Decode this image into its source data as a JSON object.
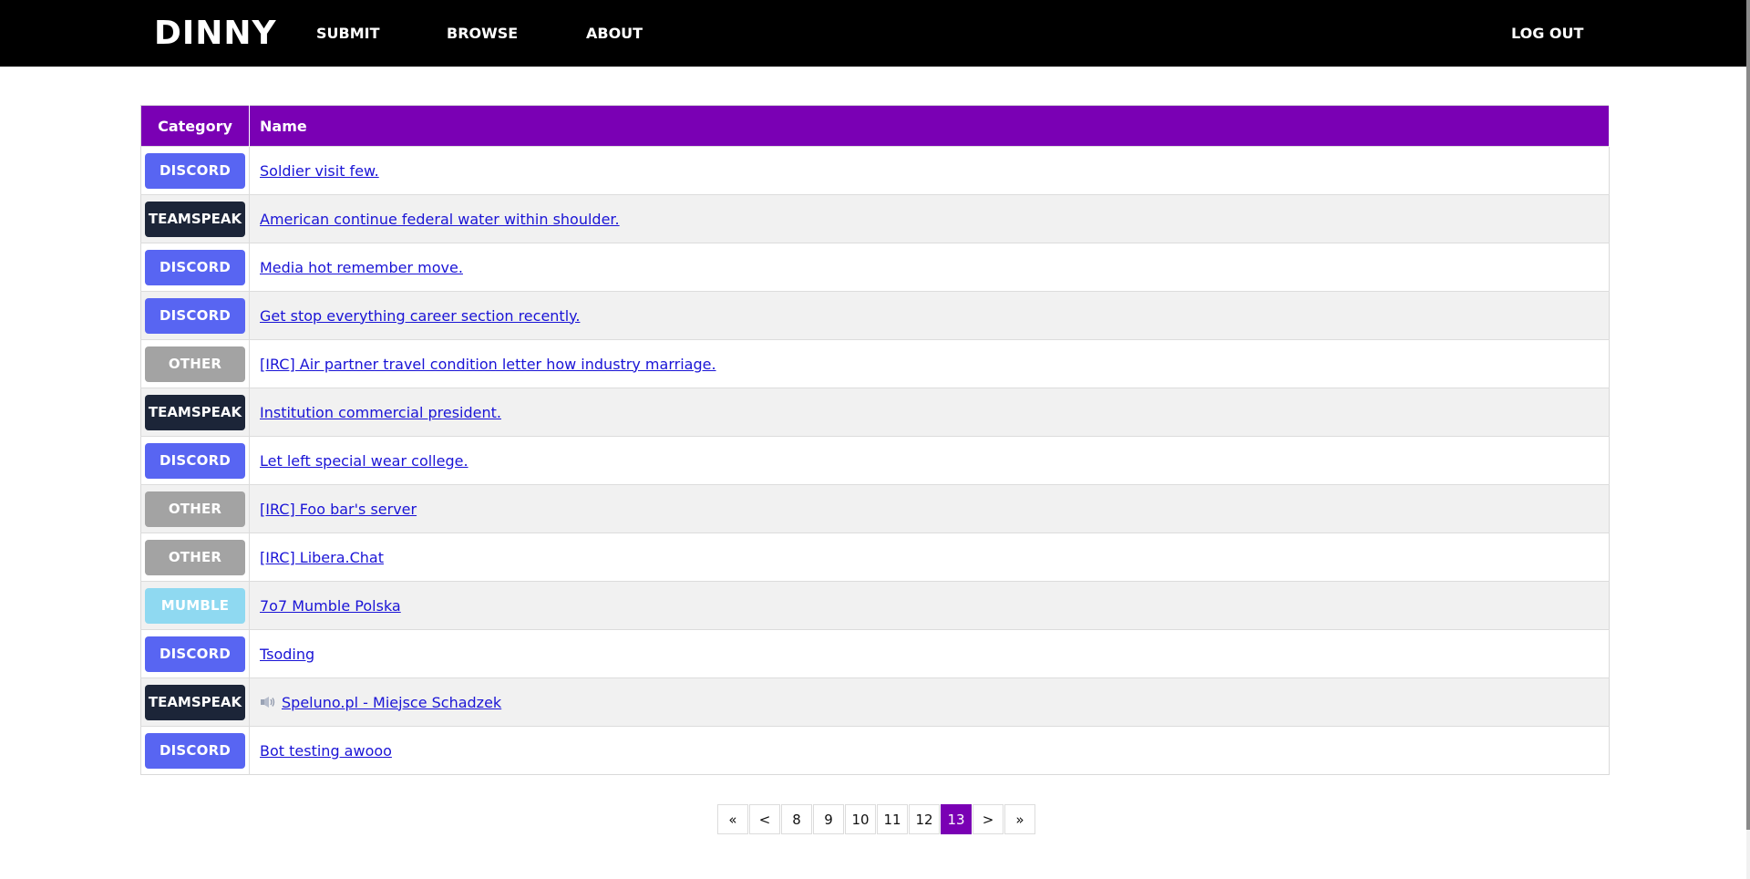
{
  "nav": {
    "brand": "DINNY",
    "submit": "SUBMIT",
    "browse": "BROWSE",
    "about": "ABOUT",
    "logout": "LOG OUT"
  },
  "table": {
    "headers": {
      "category": "Category",
      "name": "Name"
    },
    "rows": [
      {
        "category": "DISCORD",
        "type": "discord",
        "name": "Soldier visit few."
      },
      {
        "category": "TEAMSPEAK",
        "type": "teamspeak",
        "name": "American continue federal water within shoulder."
      },
      {
        "category": "DISCORD",
        "type": "discord",
        "name": "Media hot remember move."
      },
      {
        "category": "DISCORD",
        "type": "discord",
        "name": "Get stop everything career section recently."
      },
      {
        "category": "OTHER",
        "type": "other",
        "name": "[IRC] Air partner travel condition letter how industry marriage."
      },
      {
        "category": "TEAMSPEAK",
        "type": "teamspeak",
        "name": "Institution commercial president."
      },
      {
        "category": "DISCORD",
        "type": "discord",
        "name": "Let left special wear college."
      },
      {
        "category": "OTHER",
        "type": "other",
        "name": "[IRC] Foo bar's server"
      },
      {
        "category": "OTHER",
        "type": "other",
        "name": "[IRC] Libera.Chat"
      },
      {
        "category": "MUMBLE",
        "type": "mumble",
        "name": "7o7 Mumble Polska"
      },
      {
        "category": "DISCORD",
        "type": "discord",
        "name": "Tsoding"
      },
      {
        "category": "TEAMSPEAK",
        "type": "teamspeak",
        "name": "Speluno.pl - Miejsce Schadzek",
        "icon": "speaker-icon"
      },
      {
        "category": "DISCORD",
        "type": "discord",
        "name": "Bot testing awooo"
      }
    ]
  },
  "pagination": {
    "items": [
      "«",
      "<",
      "8",
      "9",
      "10",
      "11",
      "12",
      "13",
      ">",
      "»"
    ],
    "current": "13"
  },
  "colors": {
    "header_bg": "#000000",
    "accent": "#7a00b4",
    "discord": "#5865f2",
    "teamspeak": "#1c2538",
    "other": "#a3a3a3",
    "mumble": "#8fd9f1",
    "link": "#1a14d6"
  }
}
